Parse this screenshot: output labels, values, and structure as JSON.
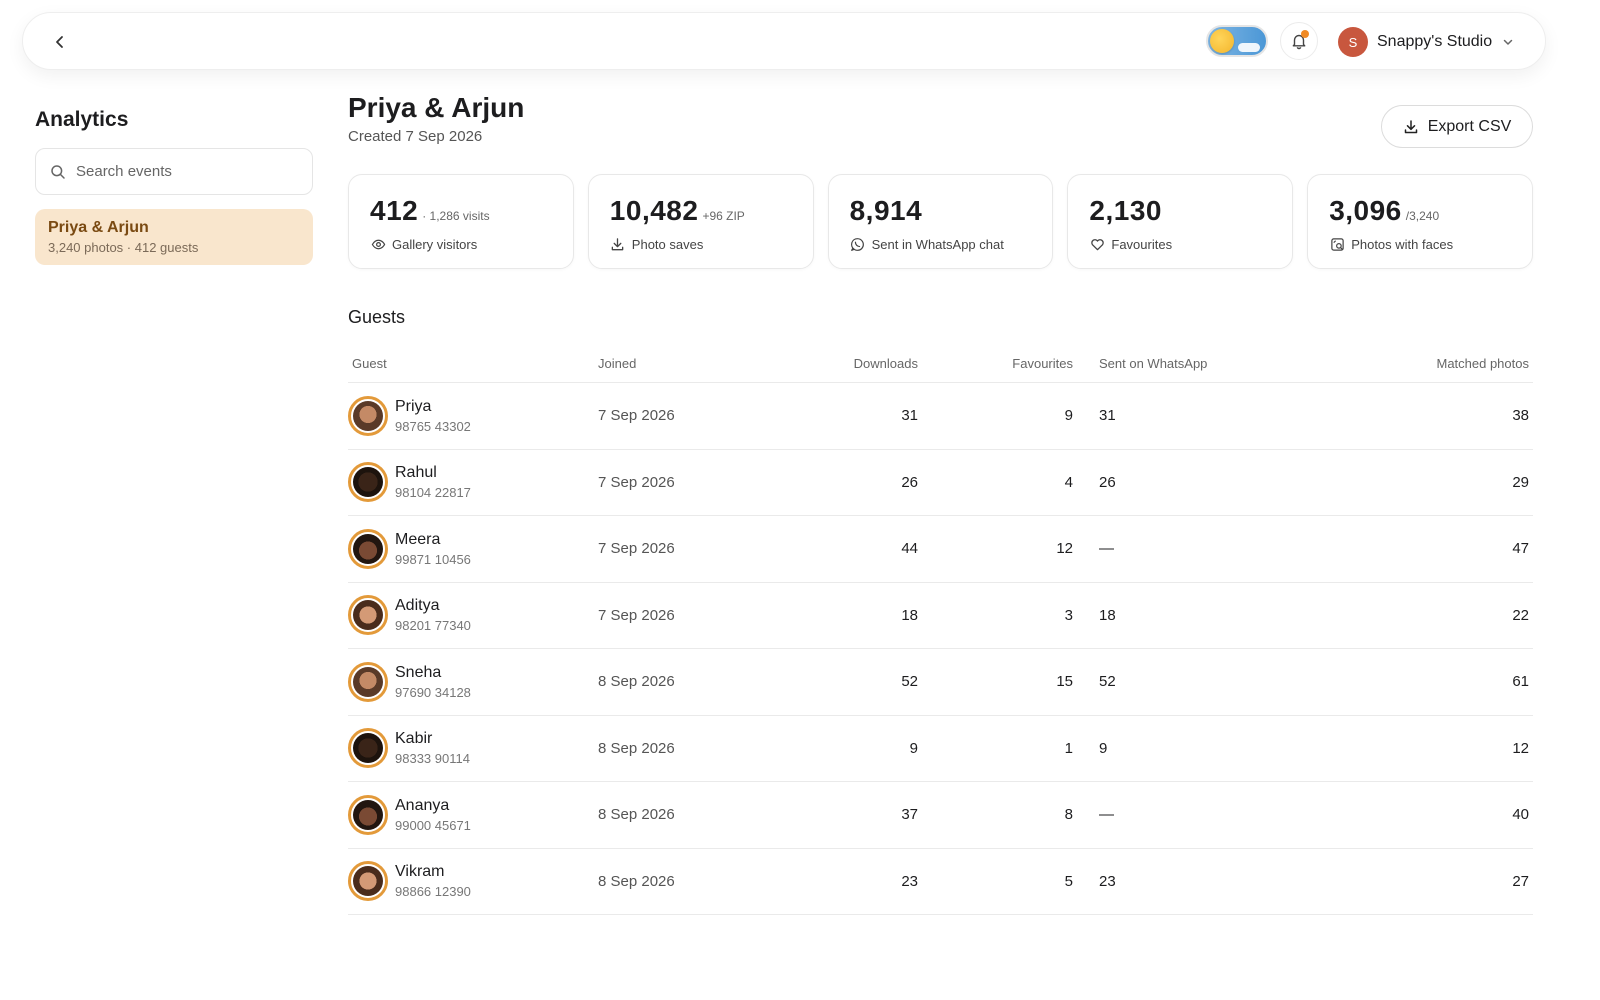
{
  "topbar": {
    "account_initial": "S",
    "account_name": "Snappy's Studio"
  },
  "sidebar": {
    "title": "Analytics",
    "search_placeholder": "Search events",
    "events": [
      {
        "name": "Priya & Arjun",
        "meta": "3,240 photos · 412 guests"
      }
    ]
  },
  "header": {
    "title": "Priya & Arjun",
    "subtitle": "Created 7 Sep 2026",
    "export_label": "Export CSV"
  },
  "stats": [
    {
      "value": "412",
      "extra": "· 1,286 visits",
      "label": "Gallery visitors",
      "icon": "eye-icon"
    },
    {
      "value": "10,482",
      "extra": "+96 ZIP",
      "label": "Photo saves",
      "icon": "download-icon"
    },
    {
      "value": "8,914",
      "extra": "",
      "label": "Sent in WhatsApp chat",
      "icon": "whatsapp-icon"
    },
    {
      "value": "2,130",
      "extra": "",
      "label": "Favourites",
      "icon": "heart-icon"
    },
    {
      "value": "3,096",
      "extra": "/3,240",
      "label": "Photos with faces",
      "icon": "face-photo-icon"
    }
  ],
  "guests": {
    "title": "Guests",
    "columns": {
      "guest": "Guest",
      "joined": "Joined",
      "downloads": "Downloads",
      "favourites": "Favourites",
      "whatsapp": "Sent on WhatsApp",
      "matched": "Matched photos"
    },
    "rows": [
      {
        "name": "Priya",
        "phone": "98765 43302",
        "joined": "7 Sep 2026",
        "downloads": "31",
        "favourites": "9",
        "whatsapp": "31",
        "matched": "38"
      },
      {
        "name": "Rahul",
        "phone": "98104 22817",
        "joined": "7 Sep 2026",
        "downloads": "26",
        "favourites": "4",
        "whatsapp": "26",
        "matched": "29"
      },
      {
        "name": "Meera",
        "phone": "99871 10456",
        "joined": "7 Sep 2026",
        "downloads": "44",
        "favourites": "12",
        "whatsapp": "—",
        "matched": "47"
      },
      {
        "name": "Aditya",
        "phone": "98201 77340",
        "joined": "7 Sep 2026",
        "downloads": "18",
        "favourites": "3",
        "whatsapp": "18",
        "matched": "22"
      },
      {
        "name": "Sneha",
        "phone": "97690 34128",
        "joined": "8 Sep 2026",
        "downloads": "52",
        "favourites": "15",
        "whatsapp": "52",
        "matched": "61"
      },
      {
        "name": "Kabir",
        "phone": "98333 90114",
        "joined": "8 Sep 2026",
        "downloads": "9",
        "favourites": "1",
        "whatsapp": "9",
        "matched": "12"
      },
      {
        "name": "Ananya",
        "phone": "99000 45671",
        "joined": "8 Sep 2026",
        "downloads": "37",
        "favourites": "8",
        "whatsapp": "—",
        "matched": "40"
      },
      {
        "name": "Vikram",
        "phone": "98866 12390",
        "joined": "8 Sep 2026",
        "downloads": "23",
        "favourites": "5",
        "whatsapp": "23",
        "matched": "27"
      }
    ]
  },
  "colors": {
    "accent": "#e39a3a",
    "selected_bg": "#f9e6cd",
    "avatar_bg": "#c8573e",
    "notification_dot": "#f08a24"
  }
}
